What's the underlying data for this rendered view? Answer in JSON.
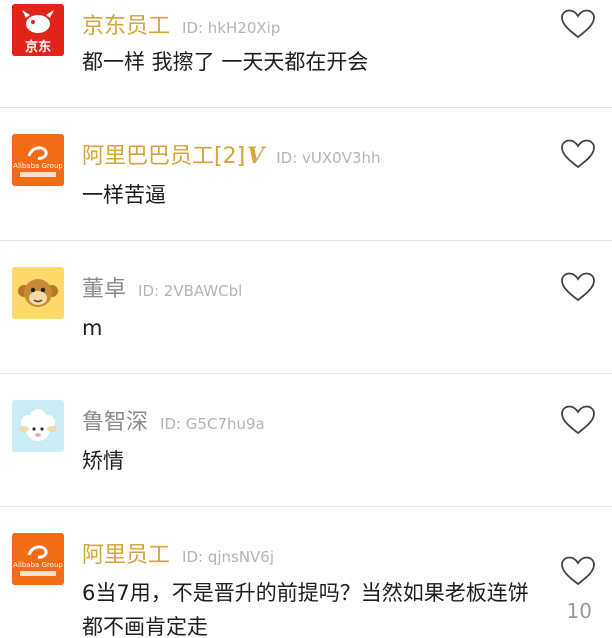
{
  "comments": [
    {
      "name": "京东员工",
      "id_text": "ID: hkH20Xip",
      "text": "都一样 我擦了 一天天都在开会",
      "avatar": "jd-logo",
      "logo_text": "京东"
    },
    {
      "name": "阿里巴巴员工[2]",
      "badge": "V",
      "id_text": "ID: vUX0V3hh",
      "text": "一样苦逼",
      "avatar": "alibaba-logo",
      "logo_text": "Alibaba Group"
    },
    {
      "name": "董卓",
      "id_text": "ID: 2VBAWCbl",
      "text": "m",
      "avatar": "monkey-avatar"
    },
    {
      "name": "鲁智深",
      "id_text": "ID: G5C7hu9a",
      "text": "矫情",
      "avatar": "sheep-avatar"
    },
    {
      "name": "阿里员工",
      "id_text": "ID: qjnsNV6j",
      "text": "6当7用，不是晋升的前提吗？当然如果老板连饼都不画肯定走",
      "avatar": "alibaba-logo",
      "logo_text": "Alibaba Group",
      "like_count": "10"
    }
  ],
  "colors": {
    "verified_name": "#d5a43a",
    "normal_name": "#8a8a8a",
    "id_text": "#b4b4b4",
    "jd_red": "#e2231a",
    "alibaba_orange": "#f26c18"
  },
  "icons": [
    "heart-outline-icon"
  ]
}
